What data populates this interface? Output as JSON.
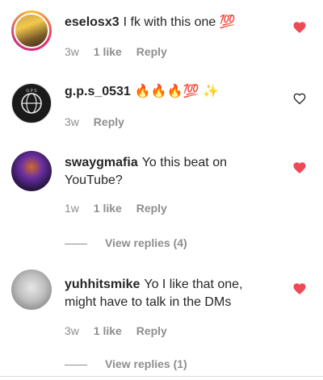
{
  "colors": {
    "liked_heart": "#ed4956",
    "muted_text": "#8e8e8e",
    "text": "#262626"
  },
  "comments": [
    {
      "username": "eselosx3",
      "text": "I fk with this one 💯",
      "time": "3w",
      "likes": "1 like",
      "reply": "Reply",
      "liked": true,
      "avatar_icon": "avatar-photo-yellow-jersey"
    },
    {
      "username": "g.p.s_0531",
      "text": "🔥🔥🔥💯 ✨",
      "time": "3w",
      "likes": "",
      "reply": "Reply",
      "liked": false,
      "avatar_icon": "avatar-logo-dark"
    },
    {
      "username": "swaygmafia",
      "text": "Yo this beat on YouTube?",
      "time": "1w",
      "likes": "1 like",
      "reply": "Reply",
      "liked": true,
      "avatar_icon": "avatar-photo-purple",
      "view_replies": "View replies (4)"
    },
    {
      "username": "yuhhitsmike",
      "text": "Yo I like that one, might have to talk in the DMs",
      "time": "3w",
      "likes": "1 like",
      "reply": "Reply",
      "liked": true,
      "avatar_icon": "avatar-photo-gray",
      "view_replies": "View replies (1)"
    }
  ]
}
